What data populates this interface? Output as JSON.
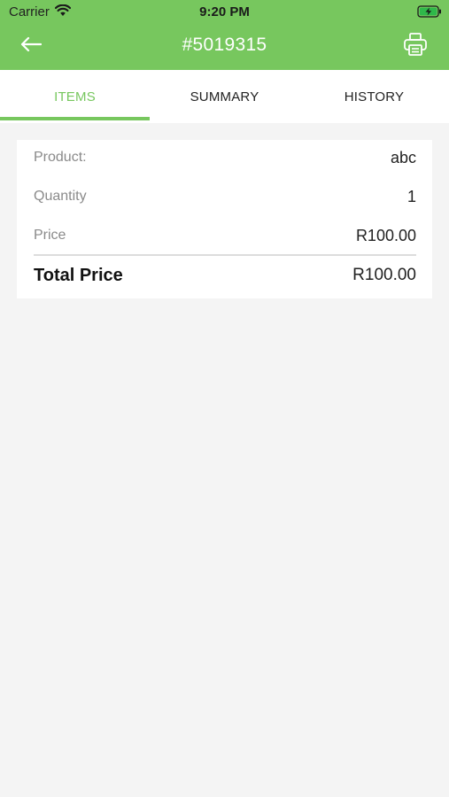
{
  "status_bar": {
    "carrier": "Carrier",
    "time": "9:20 PM"
  },
  "nav": {
    "title": "#5019315",
    "back_icon": "arrow-left-icon",
    "print_icon": "printer-icon"
  },
  "tabs": [
    {
      "label": "ITEMS",
      "active": true
    },
    {
      "label": "SUMMARY",
      "active": false
    },
    {
      "label": "HISTORY",
      "active": false
    }
  ],
  "item": {
    "product_label": "Product:",
    "product_value": "abc",
    "quantity_label": "Quantity",
    "quantity_value": "1",
    "price_label": "Price",
    "price_value": "R100.00",
    "total_label": "Total Price",
    "total_value": "R100.00"
  },
  "colors": {
    "accent": "#77c75e",
    "background": "#f4f4f4"
  }
}
